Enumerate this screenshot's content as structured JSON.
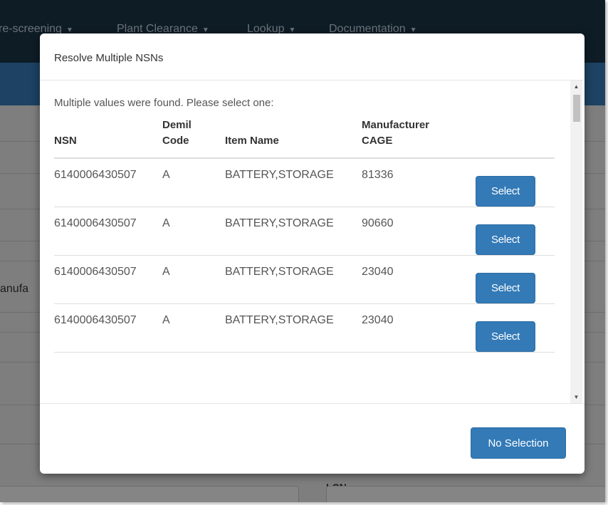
{
  "nav": {
    "items": [
      {
        "label": "re-screening"
      },
      {
        "label": "Plant Clearance"
      },
      {
        "label": "Lookup"
      },
      {
        "label": "Documentation"
      }
    ]
  },
  "background": {
    "label_partial": "anufa",
    "label_lcn": "LCN"
  },
  "modal": {
    "title": "Resolve Multiple NSNs",
    "intro": "Multiple values were found. Please select one:",
    "columns": {
      "nsn": "NSN",
      "demil_line1": "Demil",
      "demil_line2": "Code",
      "item_name": "Item Name",
      "cage_line1": "Manufacturer",
      "cage_line2": "CAGE"
    },
    "rows": [
      {
        "nsn": "6140006430507",
        "demil": "A",
        "item_name": "BATTERY,STORAGE",
        "cage": "81336",
        "action": "Select"
      },
      {
        "nsn": "6140006430507",
        "demil": "A",
        "item_name": "BATTERY,STORAGE",
        "cage": "90660",
        "action": "Select"
      },
      {
        "nsn": "6140006430507",
        "demil": "A",
        "item_name": "BATTERY,STORAGE",
        "cage": "23040",
        "action": "Select"
      },
      {
        "nsn": "6140006430507",
        "demil": "A",
        "item_name": "BATTERY,STORAGE",
        "cage": "23040",
        "action": "Select"
      }
    ],
    "no_selection_label": "No Selection"
  },
  "colors": {
    "nav_bg": "#1b3346",
    "accent_blue": "#337ab7",
    "header_bar": "#3579b5"
  }
}
